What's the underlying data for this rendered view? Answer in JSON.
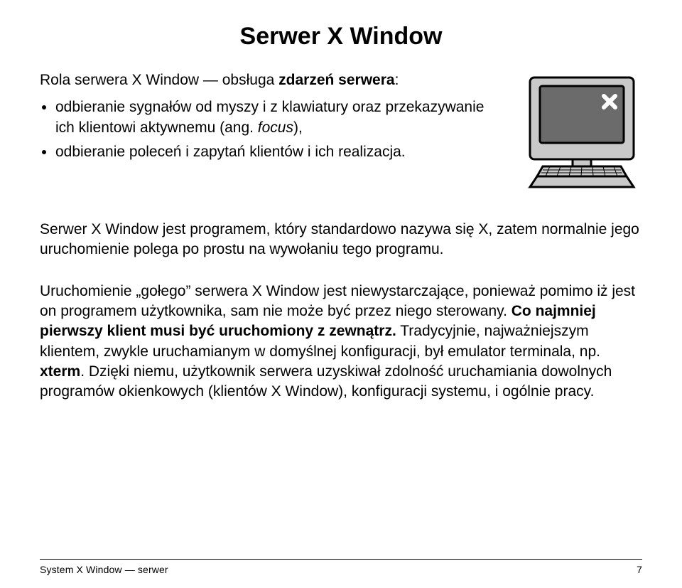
{
  "title": "Serwer X Window",
  "role_prefix": "Rola serwera X Window — obsługa ",
  "role_bold": "zdarzeń serwera",
  "role_suffix": ":",
  "bullets": [
    {
      "pre": "odbieranie sygnałów od myszy i z klawiatury oraz przekazywanie ich klientowi aktywnemu (ang. ",
      "italic": "focus",
      "post": "),"
    },
    {
      "pre": "odbieranie poleceń i zapytań klientów i ich realizacja.",
      "italic": "",
      "post": ""
    }
  ],
  "para1": "Serwer X Window jest programem, który standardowo nazywa się X, zatem normalnie jego uruchomienie polega po prostu na wywołaniu tego programu.",
  "para2": {
    "a": "Uruchomienie „gołego” serwera X Window jest niewystarczające, ponieważ pomimo iż jest on programem użytkownika, sam nie może być przez niego sterowany. ",
    "b_bold": "Co najmniej pierwszy klient musi być uruchomiony z zewnątrz.",
    "c": " Tradycyjnie, najważniejszym klientem, zwykle uruchamianym w domyślnej konfiguracji, był emulator terminala, np. ",
    "d_bold": "xterm",
    "e": ". Dzięki niemu, użytkownik serwera uzyskiwał zdolność uruchamiania dowolnych programów okienkowych (klientów X Window), konfiguracji systemu, i ogólnie pracy."
  },
  "footer_left": "System X Window — serwer",
  "footer_right": "7"
}
